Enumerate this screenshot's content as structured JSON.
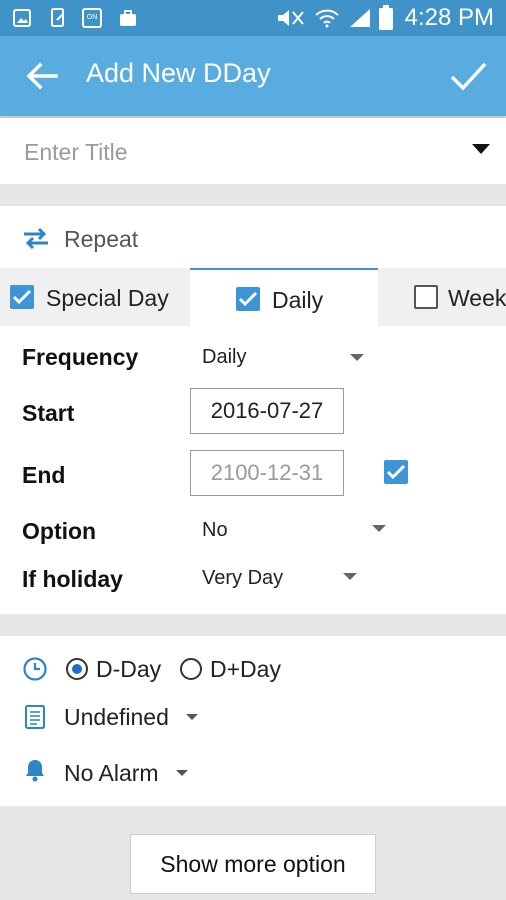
{
  "status_bar": {
    "time": "4:28 PM"
  },
  "toolbar": {
    "title": "Add New DDay"
  },
  "title_input": {
    "placeholder": "Enter Title",
    "value": ""
  },
  "repeat": {
    "label": "Repeat",
    "tabs": [
      {
        "label": "Special Day",
        "checked": true
      },
      {
        "label": "Daily",
        "checked": true,
        "selected": true
      },
      {
        "label": "Week",
        "checked": false
      }
    ]
  },
  "form": {
    "frequency_label": "Frequency",
    "frequency_value": "Daily",
    "start_label": "Start",
    "start_value": "2016-07-27",
    "end_label": "End",
    "end_value": "2100-12-31",
    "end_checked": true,
    "option_label": "Option",
    "option_value": "No",
    "holiday_label": "If holiday",
    "holiday_value": "Very Day"
  },
  "info": {
    "dday_label": "D-Day",
    "dplusday_label": "D+Day",
    "selected": "D-Day",
    "category_value": "Undefined",
    "alarm_value": "No Alarm"
  },
  "footer": {
    "more_label": "Show more option"
  },
  "colors": {
    "status_bar": "#3f93c9",
    "toolbar": "#59ace0",
    "accent": "#3d94d6",
    "background": "#e6e6e6"
  }
}
